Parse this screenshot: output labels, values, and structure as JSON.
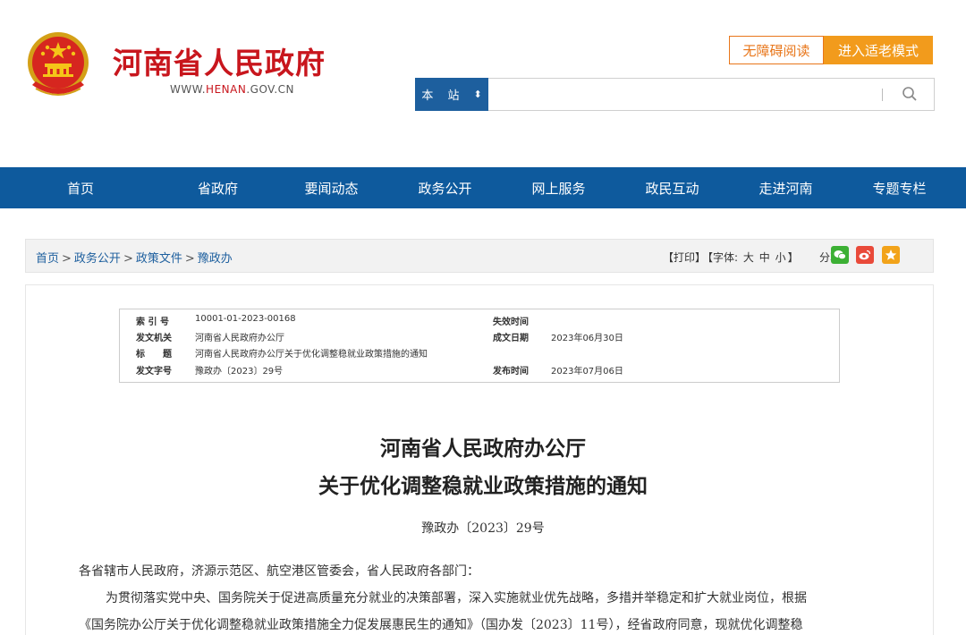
{
  "header": {
    "site_title": "河南省人民政府",
    "site_url_prefix": "WWW.",
    "site_url_highlight": "HENAN",
    "site_url_suffix": ".GOV.CN",
    "accessibility_label": "无障碍阅读",
    "elder_mode_label": "进入适老模式",
    "search": {
      "scope": "本 站",
      "scope_caret": "◆",
      "value": "",
      "placeholder": ""
    }
  },
  "colors": {
    "brand_red": "#c8161d",
    "nav_blue": "#0e5a9d",
    "orange": "#f29b1c"
  },
  "nav": {
    "items": [
      {
        "label": "首页"
      },
      {
        "label": "省政府"
      },
      {
        "label": "要闻动态"
      },
      {
        "label": "政务公开"
      },
      {
        "label": "网上服务"
      },
      {
        "label": "政民互动"
      },
      {
        "label": "走进河南"
      },
      {
        "label": "专题专栏"
      }
    ]
  },
  "breadcrumb": {
    "items": [
      "首页",
      "政务公开",
      "政策文件",
      "豫政办"
    ],
    "separator": ">"
  },
  "tools": {
    "print": "【打印】",
    "font_prefix": "【字体:",
    "font_large": "大",
    "font_medium": "中",
    "font_small": "小",
    "font_suffix": "】",
    "share_label": "分享:"
  },
  "meta": {
    "index_label": "索 引 号",
    "index_value": "10001-01-2023-00168",
    "expire_label": "失效时间",
    "expire_value": "",
    "issuer_label": "发文机关",
    "issuer_value": "河南省人民政府办公厅",
    "written_label": "成文日期",
    "written_value": "2023年06月30日",
    "title_label": "标　　题",
    "title_value": "河南省人民政府办公厅关于优化调整稳就业政策措施的通知",
    "docno_label": "发文字号",
    "docno_value": "豫政办〔2023〕29号",
    "publish_label": "发布时间",
    "publish_value": "2023年07月06日"
  },
  "document": {
    "title_line1": "河南省人民政府办公厅",
    "title_line2": "关于优化调整稳就业政策措施的通知",
    "number": "豫政办〔2023〕29号",
    "salutation": "各省辖市人民政府，济源示范区、航空港区管委会，省人民政府各部门：",
    "body_line1": "为贯彻落实党中央、国务院关于促进高质量充分就业的决策部署，深入实施就业优先战略，多措并举稳定和扩大就业岗位，根据",
    "body_line2": "《国务院办公厅关于优化调整稳就业政策措施全力促发展惠民生的通知》（国办发〔2023〕11号），经省政府同意，现就优化调整稳"
  }
}
